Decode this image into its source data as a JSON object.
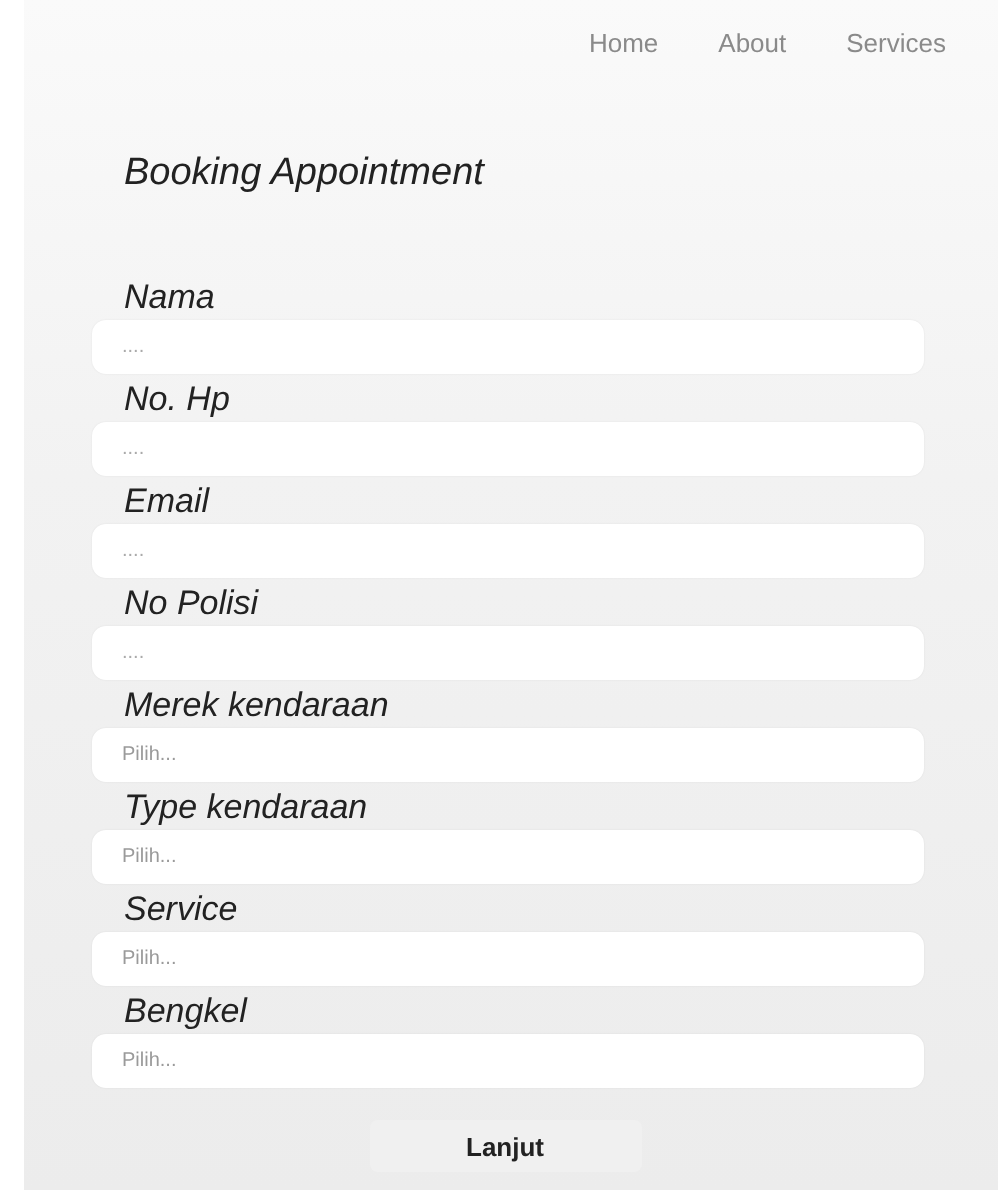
{
  "nav": [
    "Home",
    "About",
    "Services"
  ],
  "title": "Booking Appointment",
  "fields": [
    {
      "label": "Nama",
      "kind": "input",
      "placeholder": "...."
    },
    {
      "label": "No. Hp",
      "kind": "input",
      "placeholder": "...."
    },
    {
      "label": "Email",
      "kind": "input",
      "placeholder": "...."
    },
    {
      "label": "No Polisi",
      "kind": "input",
      "placeholder": "...."
    },
    {
      "label": "Merek kendaraan",
      "kind": "select",
      "placeholder": "Pilih..."
    },
    {
      "label": "Type kendaraan",
      "kind": "select",
      "placeholder": "Pilih..."
    },
    {
      "label": "Service",
      "kind": "select",
      "placeholder": "Pilih..."
    },
    {
      "label": "Bengkel",
      "kind": "select",
      "placeholder": "Pilih..."
    }
  ],
  "submit": "Lanjut"
}
